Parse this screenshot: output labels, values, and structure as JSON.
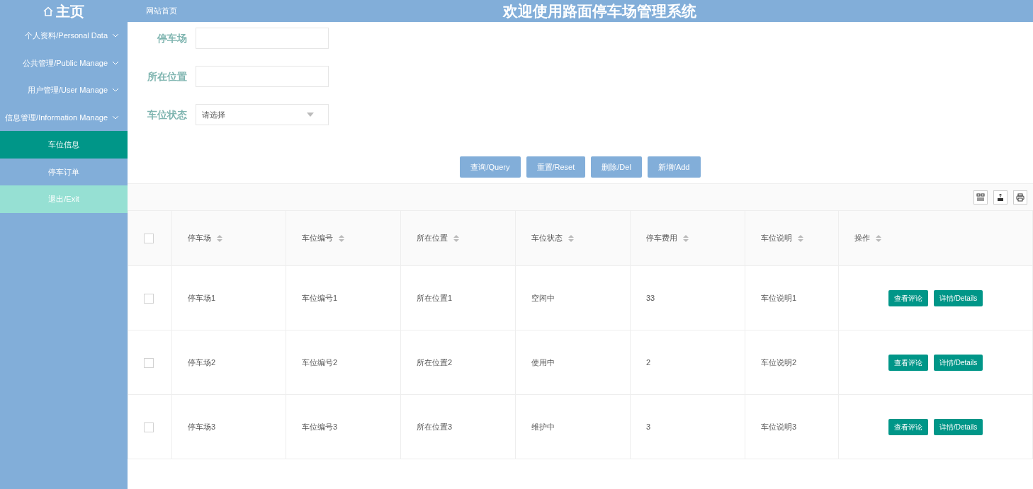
{
  "header": {
    "brand": "主页",
    "home_link": "网站首页",
    "title": "欢迎使用路面停车场管理系统"
  },
  "sidebar": {
    "items": [
      {
        "label": "个人资料/Personal Data",
        "kind": "group",
        "selected": false
      },
      {
        "label": "公共管理/Public Manage",
        "kind": "group",
        "selected": false
      },
      {
        "label": "用户管理/User Manage",
        "kind": "group",
        "selected": false
      },
      {
        "label": "信息管理/Information Manage",
        "kind": "group",
        "selected": false
      },
      {
        "label": "车位信息",
        "kind": "sub",
        "selected": true
      },
      {
        "label": "停车订单",
        "kind": "sub",
        "selected": false
      },
      {
        "label": "退出/Exit",
        "kind": "exit",
        "selected": false
      }
    ]
  },
  "search": {
    "fields": [
      {
        "label": "停车场",
        "kind": "input"
      },
      {
        "label": "所在位置",
        "kind": "input"
      },
      {
        "label": "车位状态",
        "kind": "select",
        "placeholder": "请选择"
      }
    ],
    "buttons": [
      "查询/Query",
      "重置/Reset",
      "删除/Del",
      "新增/Add"
    ]
  },
  "table": {
    "all_checked": false,
    "columns": [
      "停车场",
      "车位编号",
      "所在位置",
      "车位状态",
      "停车费用",
      "车位说明",
      "操作"
    ],
    "rows": [
      {
        "cells": [
          "停车场1",
          "车位编号1",
          "所在位置1",
          "空闲中",
          "33",
          "车位说明1"
        ],
        "checked": false,
        "actions": [
          "查看评论",
          "详情/Details"
        ]
      },
      {
        "cells": [
          "停车场2",
          "车位编号2",
          "所在位置2",
          "使用中",
          "2",
          "车位说明2"
        ],
        "checked": false,
        "actions": [
          "查看评论",
          "详情/Details"
        ]
      },
      {
        "cells": [
          "停车场3",
          "车位编号3",
          "所在位置3",
          "维护中",
          "3",
          "车位说明3"
        ],
        "checked": false,
        "actions": [
          "查看评论",
          "详情/Details"
        ]
      }
    ]
  }
}
